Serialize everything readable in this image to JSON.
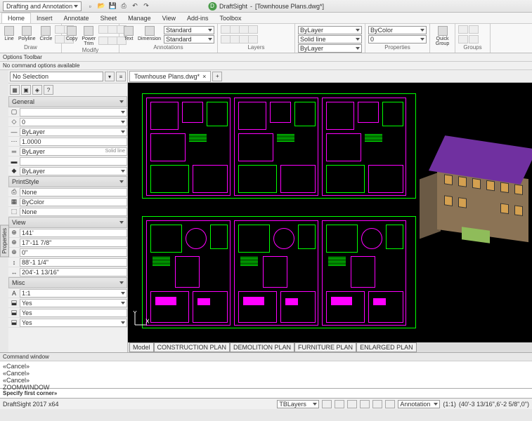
{
  "title": {
    "app": "DraftSight",
    "doc": "[Townhouse Plans.dwg*]"
  },
  "workspace_dd": "Drafting and Annotation",
  "menu": {
    "home": "Home",
    "insert": "Insert",
    "annotate": "Annotate",
    "sheet": "Sheet",
    "manage": "Manage",
    "view": "View",
    "addins": "Add-ins",
    "toolbox": "Toolbox"
  },
  "ribbon": {
    "draw": {
      "label": "Draw",
      "line": "Line",
      "polyline": "Polyline",
      "circle": "Circle"
    },
    "modify": {
      "label": "Modify",
      "copy": "Copy",
      "power": "Power Trim"
    },
    "annotations": {
      "label": "Annotations",
      "text": "Text",
      "dim": "Dimension",
      "std1": "Standard",
      "std2": "Standard"
    },
    "layers": {
      "label": "Layers",
      "bylayer": "ByLayer",
      "solid": "Solid line",
      "bylayer2": "ByLayer"
    },
    "properties": {
      "label": "Properties",
      "bycolor": "ByColor",
      "zero": "0"
    },
    "quick": {
      "label": "Quick Group",
      "btn": "Quick\nGroup"
    },
    "groups": {
      "label": "Groups"
    }
  },
  "options_toolbar": {
    "title": "Options Toolbar",
    "msg": "No command options available"
  },
  "props": {
    "no_selection": "No Selection",
    "sections": {
      "general": {
        "label": "General",
        "rows": {
          "color": "",
          "layer": "0",
          "ltype": "ByLayer",
          "lscale": "1.0000",
          "lweight": "ByLayer",
          "lstyle": "Solid line",
          "thick": "",
          "style": "ByLayer"
        }
      },
      "printstyle": {
        "label": "PrintStyle",
        "rows": {
          "ps": "None",
          "pstable": "ByColor",
          "att": "None"
        }
      },
      "view": {
        "label": "View",
        "rows": {
          "cx": "141'",
          "cy": "17'-11 7/8\"",
          "cz": "0\"",
          "h": "88'-1 1/4\"",
          "w": "204'-1 13/16\""
        }
      },
      "misc": {
        "label": "Misc",
        "rows": {
          "ann": "1:1",
          "ucs": "Yes",
          "u2": "Yes",
          "u3": "Yes"
        }
      }
    }
  },
  "doc_tab": "Townhouse Plans.dwg*",
  "model_tabs": [
    "Model",
    "CONSTRUCTION PLAN",
    "DEMOLITION PLAN",
    "FURNITURE PLAN",
    "ENLARGED PLAN"
  ],
  "cmd": {
    "hdr": "Command window",
    "lines": [
      "«Cancel»",
      "«Cancel»",
      "«Cancel»",
      "ZOOMWINDOW"
    ],
    "prompt": "Specify first corner»"
  },
  "status": {
    "left": "DraftSight 2017 x64",
    "layers": "TBLayers",
    "annotation": "Annotation",
    "scale": "(1:1)",
    "coords": "(40'-3 13/16\",6'-2 5/8\",0\")"
  },
  "props_side_tab": "Properties"
}
